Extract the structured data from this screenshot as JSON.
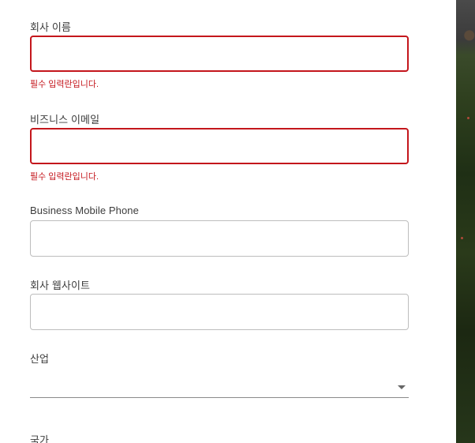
{
  "form": {
    "company_name": {
      "label": "회사 이름",
      "value": "",
      "error": "필수 입력란입니다."
    },
    "business_email": {
      "label": "비즈니스 이메일",
      "value": "",
      "error": "필수 입력란입니다."
    },
    "mobile_phone": {
      "label": "Business Mobile Phone",
      "value": ""
    },
    "company_website": {
      "label": "회사 웹사이트",
      "value": ""
    },
    "industry": {
      "label": "산업",
      "selected": ""
    },
    "country": {
      "label": "국가"
    }
  },
  "colors": {
    "error": "#c4161c",
    "border": "#bdbdbd",
    "label": "#3c3c3c"
  },
  "icons": {
    "industry_dropdown": "caret-down-icon"
  }
}
